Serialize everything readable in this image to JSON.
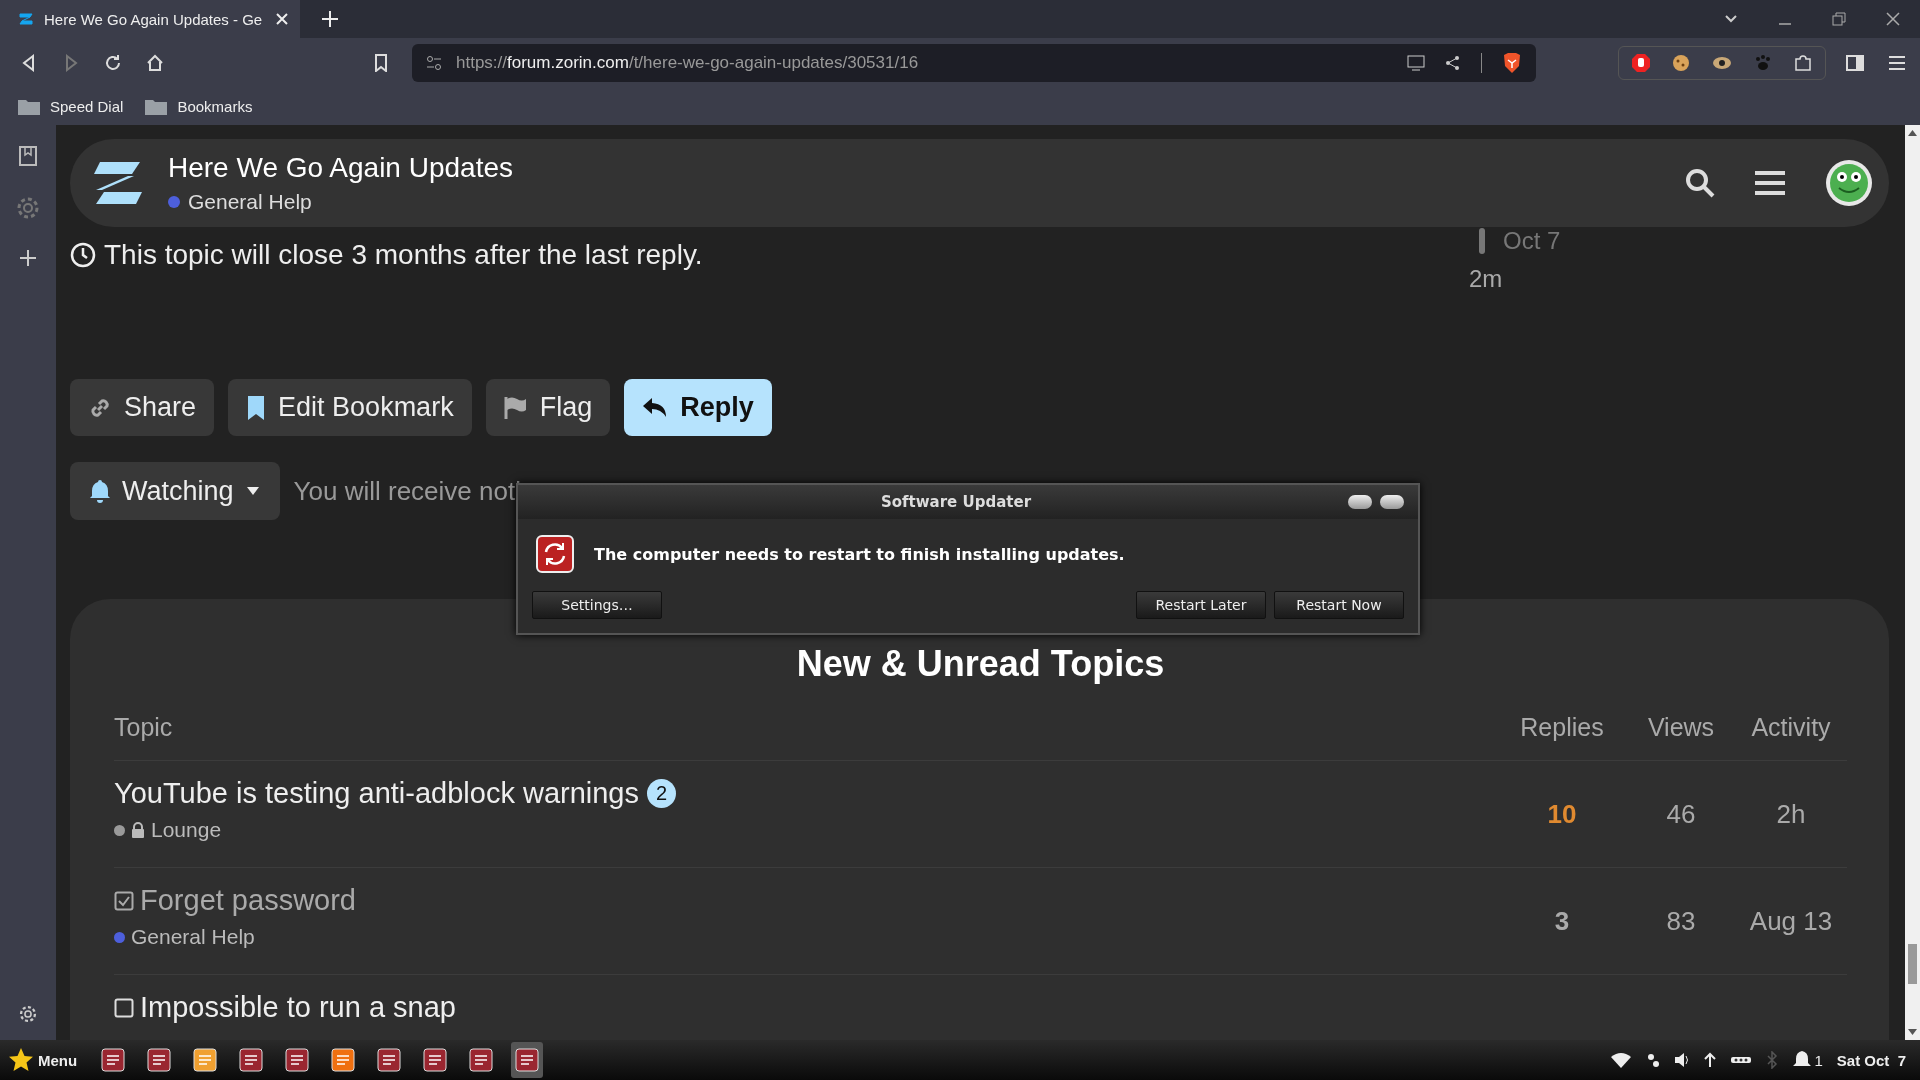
{
  "browser": {
    "tabs": [
      {
        "title": "Here We Go Again Updates - Ge",
        "selected": true
      }
    ],
    "url": {
      "scheme": "https://",
      "host": "forum.zorin.com",
      "path": "/t/here-we-go-again-updates/30531/16"
    },
    "bookmarks": [
      "Speed Dial",
      "Bookmarks"
    ]
  },
  "forum_header": {
    "title": "Here We Go Again Updates",
    "category": {
      "name": "General Help",
      "color": "#4d5fdc"
    }
  },
  "timeline": {
    "date": "Oct 7",
    "age": "2m"
  },
  "notice": "This topic will close 3 months after the last reply.",
  "actions": [
    {
      "label": "Share",
      "kind": "share",
      "primary": false
    },
    {
      "label": "Edit Bookmark",
      "kind": "bookmark",
      "primary": false
    },
    {
      "label": "Flag",
      "kind": "flag",
      "primary": false
    },
    {
      "label": "Reply",
      "kind": "reply",
      "primary": true
    }
  ],
  "notification": {
    "label": "Watching",
    "description": "You will receive noti"
  },
  "dialog": {
    "title": "Software Updater",
    "message": "The computer needs to restart to finish installing updates.",
    "buttons": [
      "Settings…",
      "Restart Later",
      "Restart Now"
    ]
  },
  "topics": {
    "title": "New & Unread Topics",
    "columns": [
      "Topic",
      "Replies",
      "Views",
      "Activity"
    ],
    "rows": [
      {
        "kind": "topic",
        "title": "YouTube is testing anti-adblock warnings",
        "unread": "2",
        "visited": false,
        "category": {
          "name": "Lounge",
          "color": "#9a9a9a",
          "locked": true
        },
        "replies": "10",
        "hot": true,
        "views": "46",
        "activity": "2h"
      },
      {
        "kind": "solved",
        "title": "Forget password",
        "visited": true,
        "category": {
          "name": "General Help",
          "color": "#4d5fdc",
          "locked": false
        },
        "replies": "3",
        "hot": false,
        "views": "83",
        "activity": "Aug 13"
      },
      {
        "kind": "unsolved",
        "title": "Impossible to run a snap",
        "visited": false
      }
    ]
  },
  "taskbar": {
    "menu": "Menu",
    "notifications": "1",
    "clock": "Sat Oct  7"
  }
}
